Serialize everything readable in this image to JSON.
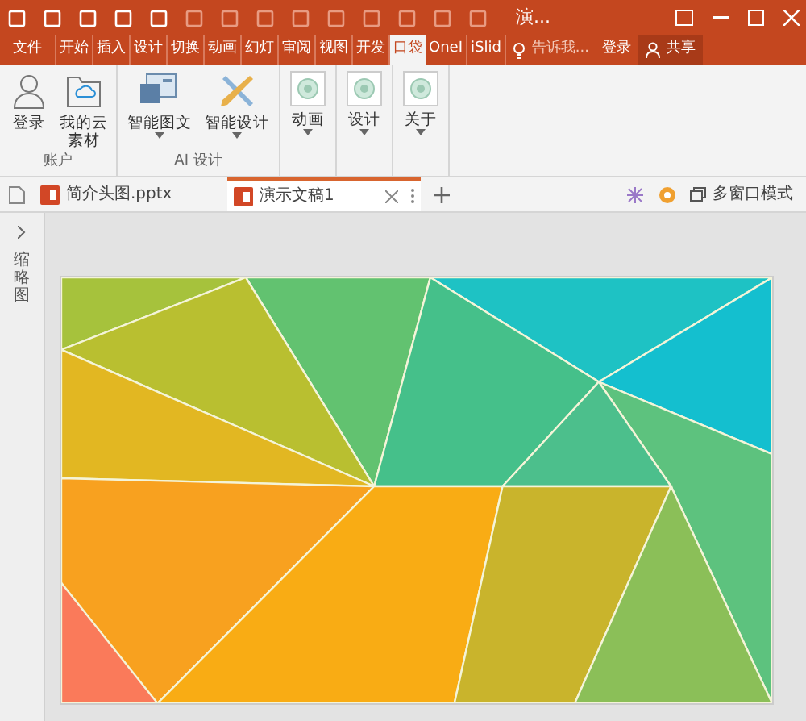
{
  "window": {
    "title": "演..."
  },
  "ribbon_tabs": [
    {
      "label": "文件",
      "selected": false
    },
    {
      "label": "开始",
      "selected": false
    },
    {
      "label": "插入",
      "selected": false
    },
    {
      "label": "设计",
      "selected": false
    },
    {
      "label": "切换",
      "selected": false
    },
    {
      "label": "动画",
      "selected": false
    },
    {
      "label": "幻灯",
      "selected": false
    },
    {
      "label": "审阅",
      "selected": false
    },
    {
      "label": "视图",
      "selected": false
    },
    {
      "label": "开发",
      "selected": false
    },
    {
      "label": "口袋",
      "selected": true
    },
    {
      "label": "OneI",
      "selected": false
    },
    {
      "label": "iSlid",
      "selected": false
    }
  ],
  "tell_me": {
    "placeholder": "告诉我..."
  },
  "sign_in": "登录",
  "share": "共享",
  "ribbon_groups": [
    {
      "label": "账户",
      "buttons": [
        {
          "kind": "person",
          "label": "登录",
          "dropdown": false
        },
        {
          "kind": "cloud",
          "label": "我的云素材",
          "dropdown": false
        }
      ]
    },
    {
      "label": "AI 设计",
      "buttons": [
        {
          "kind": "layout",
          "label": "智能图文",
          "dropdown": true
        },
        {
          "kind": "tools",
          "label": "智能设计",
          "dropdown": true
        }
      ]
    },
    {
      "buttons": [
        {
          "kind": "circle",
          "label": "动画",
          "dropdown": true
        }
      ]
    },
    {
      "buttons": [
        {
          "kind": "circle",
          "label": "设计",
          "dropdown": true
        }
      ]
    },
    {
      "buttons": [
        {
          "kind": "circle",
          "label": "关于",
          "dropdown": true
        }
      ]
    }
  ],
  "doc_tabs": [
    {
      "label": "简介头图.pptx",
      "selected": false
    },
    {
      "label": "演示文稿1",
      "selected": true
    }
  ],
  "multi_window": "多窗口模式",
  "thumbnail_pane": {
    "label": "缩略图"
  }
}
